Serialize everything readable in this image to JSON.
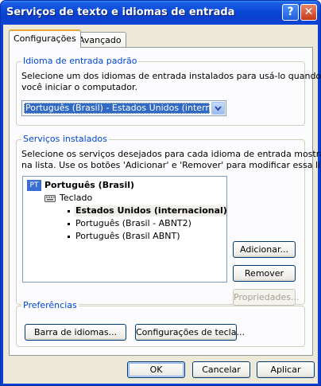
{
  "window": {
    "title": "Serviços de texto e idiomas de entrada",
    "help_label": "?",
    "close_label": "✕"
  },
  "tabs": [
    {
      "label": "Configurações",
      "active": true
    },
    {
      "label": "Avançado",
      "active": false
    }
  ],
  "default_language": {
    "legend": "Idioma de entrada padrão",
    "description_line1": "Selecione um dos idiomas de entrada instalados para usá-lo quando",
    "description_line2": "você iniciar o computador.",
    "selected": "Português (Brasil) - Estados Unidos (internacional)"
  },
  "installed_services": {
    "legend": "Serviços instalados",
    "description_line1": "Selecione os serviços desejados para cada idioma de entrada mostrado",
    "description_line2": "na lista. Use os botões 'Adicionar' e 'Remover' para modificar essa lista.",
    "language_badge": "PT",
    "language": "Português (Brasil)",
    "category": "Teclado",
    "layouts": [
      "Estados Unidos (internacional)",
      "Português (Brasil - ABNT2)",
      "Português (Brasil ABNT)"
    ],
    "add_label": "Adicionar...",
    "remove_label": "Remover",
    "properties_label": "Propriedades..."
  },
  "preferences": {
    "legend": "Preferências",
    "language_bar_label": "Barra de idiomas...",
    "key_settings_label": "Configurações de tecla..."
  },
  "footer": {
    "ok_label": "OK",
    "cancel_label": "Cancelar",
    "apply_label": "Aplicar"
  }
}
